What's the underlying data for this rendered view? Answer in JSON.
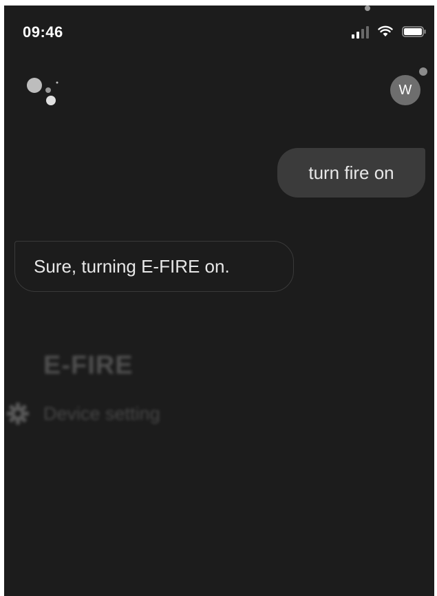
{
  "status_bar": {
    "time": "09:46",
    "signal_icon": "cellular-signal-icon",
    "wifi_icon": "wifi-icon",
    "battery_icon": "battery-icon"
  },
  "header": {
    "assistant_logo": "assistant-dots-icon",
    "avatar_initial": "W"
  },
  "conversation": {
    "user_message": "turn fire on",
    "assistant_message": "Sure, turning E-FIRE on."
  },
  "device_card": {
    "title": "E-FIRE",
    "setting_icon": "gear-icon",
    "setting_label": "Device setting"
  },
  "colors": {
    "background": "#1c1c1c",
    "user_bubble": "#3b3b3b",
    "text": "#e8e8e8",
    "avatar": "#6e6e6e"
  }
}
